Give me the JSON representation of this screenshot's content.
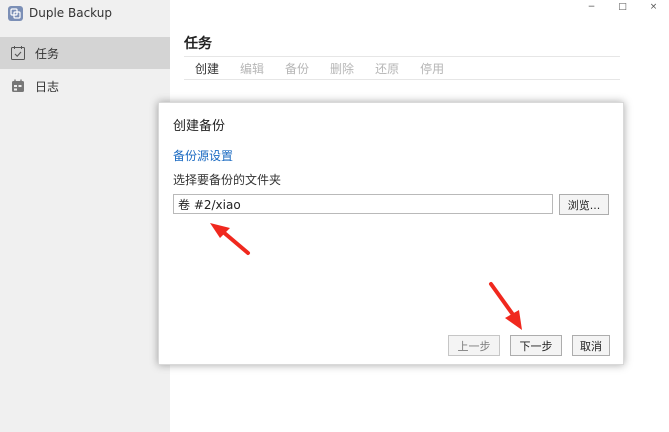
{
  "app": {
    "title": "Duple Backup"
  },
  "window_controls": {
    "minimize": "−",
    "maximize": "□",
    "close": "×"
  },
  "sidebar": {
    "items": [
      {
        "label": "任务",
        "icon": "calendar-check-icon",
        "active": true
      },
      {
        "label": "日志",
        "icon": "log-icon",
        "active": false
      }
    ]
  },
  "main": {
    "title": "任务",
    "toolbar": [
      {
        "label": "创建",
        "enabled": true
      },
      {
        "label": "编辑",
        "enabled": false
      },
      {
        "label": "备份",
        "enabled": false
      },
      {
        "label": "删除",
        "enabled": false
      },
      {
        "label": "还原",
        "enabled": false
      },
      {
        "label": "停用",
        "enabled": false
      }
    ]
  },
  "dialog": {
    "title": "创建备份",
    "section_title": "备份源设置",
    "description": "选择要备份的文件夹",
    "path_value": "卷 #2/xiao",
    "browse_label": "浏览...",
    "prev_label": "上一步",
    "next_label": "下一步",
    "cancel_label": "取消"
  },
  "colors": {
    "sidebar_bg": "#f0f0f0",
    "active_item_bg": "#d4d4d4",
    "link_blue": "#1a6ac2",
    "arrow_red": "#f0281e"
  }
}
